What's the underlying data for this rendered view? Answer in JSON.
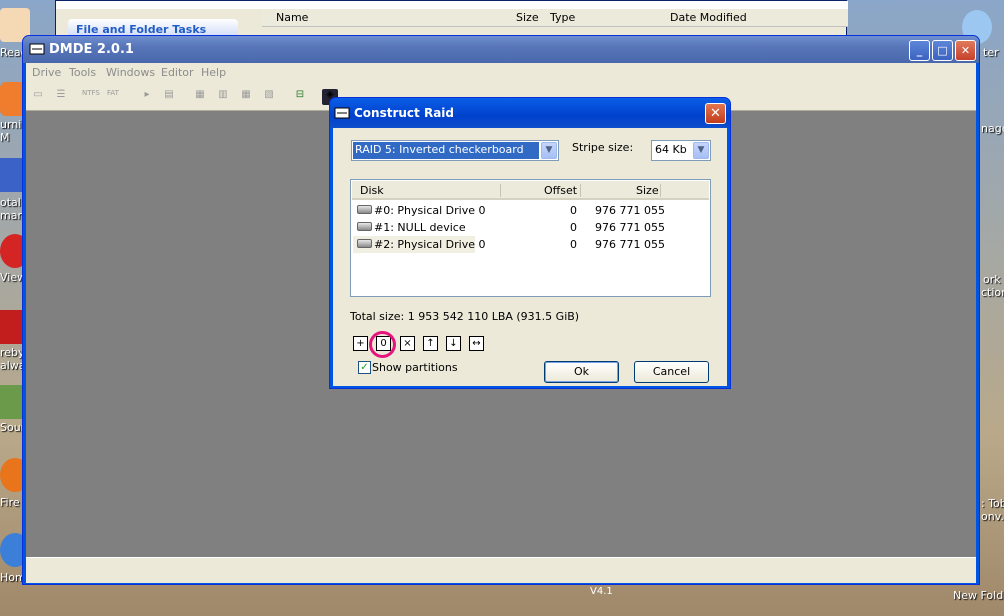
{
  "desktop": {
    "icons": [
      {
        "label": "Read"
      },
      {
        "label": "urnir"
      },
      {
        "label": "M"
      },
      {
        "label": "otal"
      },
      {
        "label": "mande"
      },
      {
        "label": "View"
      },
      {
        "label": "reby"
      },
      {
        "label": "alwa"
      },
      {
        "label": "Sourc"
      },
      {
        "label": "Fire"
      },
      {
        "label": "Hom"
      }
    ],
    "right_labels": [
      "ter",
      "nage",
      "ork",
      "ctions",
      ": Tob",
      "onv..",
      "New Folde"
    ],
    "version_text": "V4.1"
  },
  "explorer": {
    "tasks_title": "File and Folder Tasks",
    "columns": [
      "Name",
      "Size",
      "Type",
      "Date Modified"
    ]
  },
  "app": {
    "title": "DMDE 2.0.1",
    "menu": [
      "Drive",
      "Tools",
      "Windows",
      "Editor",
      "Help"
    ],
    "toolbar": [
      "NTFS",
      "FAT"
    ]
  },
  "dialog": {
    "title": "Construct Raid",
    "raid_type": "RAID 5: Inverted checkerboard",
    "stripe_label": "Stripe size:",
    "stripe_value": "64 Kb",
    "columns": {
      "disk": "Disk",
      "offset": "Offset",
      "size": "Size"
    },
    "rows": [
      {
        "disk": "#0: Physical Drive 0",
        "offset": "0",
        "size": "976 771 055"
      },
      {
        "disk": "#1: NULL device",
        "offset": "0",
        "size": "976 771 055"
      },
      {
        "disk": "#2: Physical Drive 0",
        "offset": "0",
        "size": "976 771 055"
      }
    ],
    "total": "Total size: 1 953 542 110 LBA (931.5 GiB)",
    "buttons": {
      "add": "+",
      "null": "0",
      "remove": "×",
      "up": "↑",
      "down": "↓",
      "swap": "↔"
    },
    "show_partitions": "Show partitions",
    "ok": "Ok",
    "cancel": "Cancel"
  }
}
